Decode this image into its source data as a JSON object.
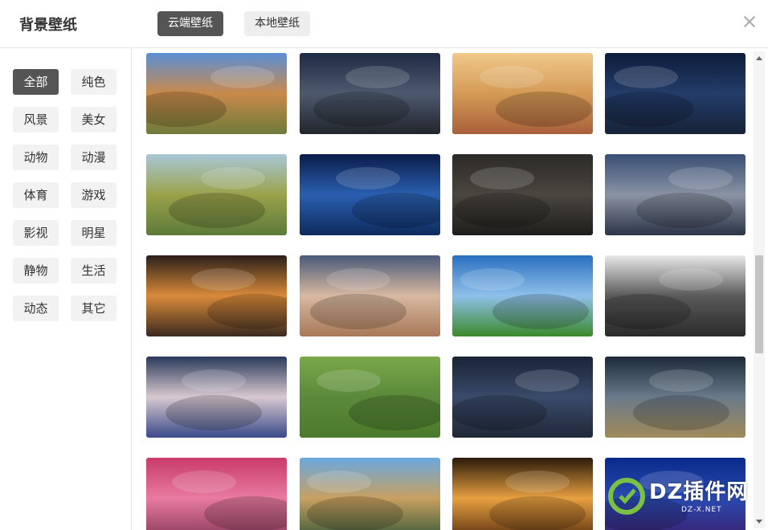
{
  "header": {
    "title": "背景壁纸",
    "tab_cloud": "云端壁纸",
    "tab_local": "本地壁纸"
  },
  "categories": [
    "全部",
    "纯色",
    "风景",
    "美女",
    "动物",
    "动漫",
    "体育",
    "游戏",
    "影视",
    "明星",
    "静物",
    "生活",
    "动态",
    "其它"
  ],
  "active_category": "全部",
  "watermark": {
    "text": "DZ插件网",
    "sub": "DZ-X.NET"
  },
  "thumbs": [
    {
      "g": [
        "#5b8fd6",
        "#c98a4a",
        "#6f7a3a"
      ]
    },
    {
      "g": [
        "#1f2a44",
        "#4d5a6e",
        "#22252c"
      ]
    },
    {
      "g": [
        "#f1c98a",
        "#d49a55",
        "#a9603a"
      ]
    },
    {
      "g": [
        "#0e1c3a",
        "#233d6a",
        "#172238"
      ]
    },
    {
      "g": [
        "#a9c7d6",
        "#9aa24a",
        "#5d7a3a"
      ]
    },
    {
      "g": [
        "#0b1c4a",
        "#2a5fb0",
        "#0e2a5e"
      ]
    },
    {
      "g": [
        "#2c2a27",
        "#4a4640",
        "#1e1d1b"
      ]
    },
    {
      "g": [
        "#394e74",
        "#8a93a4",
        "#2c3447"
      ]
    },
    {
      "g": [
        "#2a1f1a",
        "#d98a3a",
        "#3b2a20"
      ]
    },
    {
      "g": [
        "#4a5a7a",
        "#d8b8a0",
        "#a87858"
      ]
    },
    {
      "g": [
        "#2a6fc0",
        "#8fc0ea",
        "#3a8a2a"
      ]
    },
    {
      "g": [
        "#e8e8e8",
        "#5a5a5a",
        "#2a2a2a"
      ]
    },
    {
      "g": [
        "#2a3a5a",
        "#d8c8d0",
        "#3a4a8a"
      ]
    },
    {
      "g": [
        "#7aa84a",
        "#5a8a3a",
        "#4a7a2a"
      ]
    },
    {
      "g": [
        "#1a2436",
        "#3a4a6a",
        "#202838"
      ]
    },
    {
      "g": [
        "#1c2a3a",
        "#6a7a8a",
        "#a08a5a"
      ]
    },
    {
      "g": [
        "#c83a6a",
        "#e87aa0",
        "#8a3a5a"
      ]
    },
    {
      "g": [
        "#6aa8e0",
        "#c8a060",
        "#3a5a3a"
      ]
    },
    {
      "g": [
        "#2a1a0a",
        "#e8a040",
        "#5a3010"
      ]
    },
    {
      "g": [
        "#0a2a8a",
        "#2a4ab0",
        "#3a2070"
      ]
    }
  ]
}
